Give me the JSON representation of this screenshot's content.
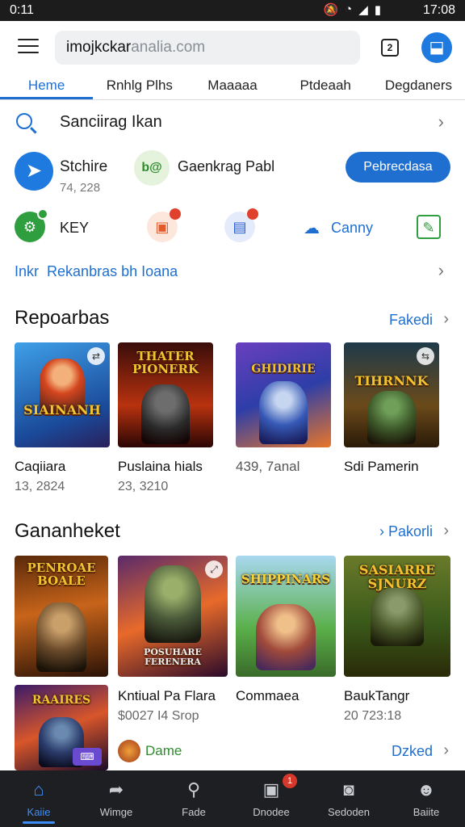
{
  "status_bar": {
    "time": "0:11",
    "clock": "17:08",
    "icons": [
      "mute-icon",
      "wifi-icon",
      "signal-icon",
      "battery-icon"
    ]
  },
  "address_bar": {
    "url_main": "imojkckar",
    "url_suffix": "analia.com"
  },
  "nav_tabs": [
    "Heme",
    "Rnhlg Plhs",
    "Maaaaa",
    "Ptdeaah",
    "Degdaners"
  ],
  "search_row": {
    "label": "Sanciirag Ikan"
  },
  "account": {
    "name": "Stchire",
    "count": "74, 228",
    "secondary_icon_text": "b@",
    "secondary_label": "Gaenkrag Pabl",
    "button_label": "Pebrecdasa"
  },
  "quick_row": {
    "key_label": "KEY",
    "canny_label": "Canny"
  },
  "link_row": {
    "prefix": "Inkr",
    "text": "Rekanbras bh Ioana"
  },
  "section1": {
    "title": "Repoarbas",
    "more": "Fakedi",
    "cards": [
      {
        "art": "SIAINANH",
        "title": "Caqiiara",
        "sub": "13, 2824"
      },
      {
        "art": "THATER PIONERK",
        "title": "Puslaina hials",
        "sub": "23, 3210"
      },
      {
        "art": "GHIDIRIE",
        "title": "439, 7anal",
        "sub": ""
      },
      {
        "art": "TIHRNNK",
        "title": "Sdi Pamerin",
        "sub": ""
      }
    ]
  },
  "section2": {
    "title": "Gananheket",
    "more": "Pakorli",
    "cards": [
      {
        "art": "PENROAE BOALE",
        "title": "",
        "sub": ""
      },
      {
        "art": "POSUHARE FERENERA",
        "title": "Kntiual Pa Flara",
        "sub": "$0027 I4 Srop"
      },
      {
        "art": "SHIPPINARS",
        "title": "Commaea",
        "sub": ""
      },
      {
        "art": "SASIARRE SJNURZ",
        "title": "BaukTangr",
        "sub": "20 723:18"
      },
      {
        "art": "RAAIRES",
        "title": "",
        "sub": ""
      }
    ],
    "extra_label": "Dame",
    "extra_more": "Dzked"
  },
  "bottom_nav": [
    {
      "label": "Kaiie",
      "icon": "home-icon"
    },
    {
      "label": "Wimge",
      "icon": "share-icon"
    },
    {
      "label": "Fade",
      "icon": "search-icon"
    },
    {
      "label": "Dnodee",
      "icon": "store-icon",
      "badge": "1"
    },
    {
      "label": "Sedoden",
      "icon": "tv-icon"
    },
    {
      "label": "Baiite",
      "icon": "person-icon"
    }
  ]
}
